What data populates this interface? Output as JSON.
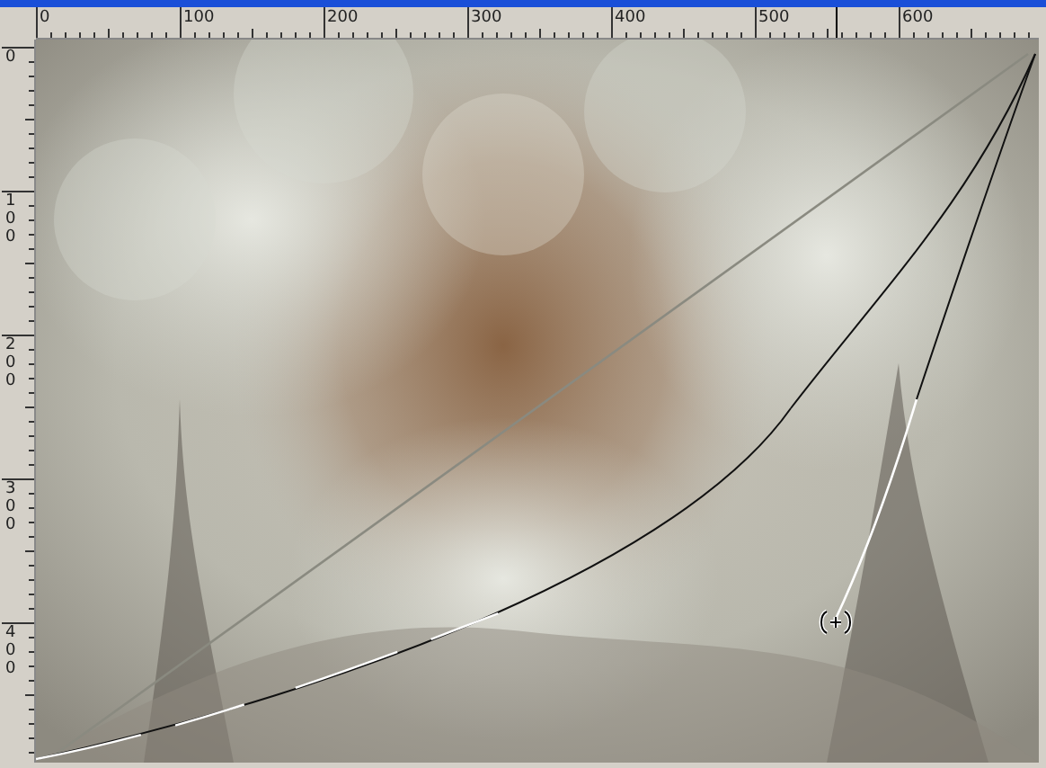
{
  "horizontal_ruler": {
    "labels": [
      "0",
      "100",
      "200",
      "300",
      "400",
      "500",
      "600"
    ]
  },
  "vertical_ruler": {
    "labels": [
      "0",
      "100",
      "200",
      "300",
      "400"
    ]
  }
}
